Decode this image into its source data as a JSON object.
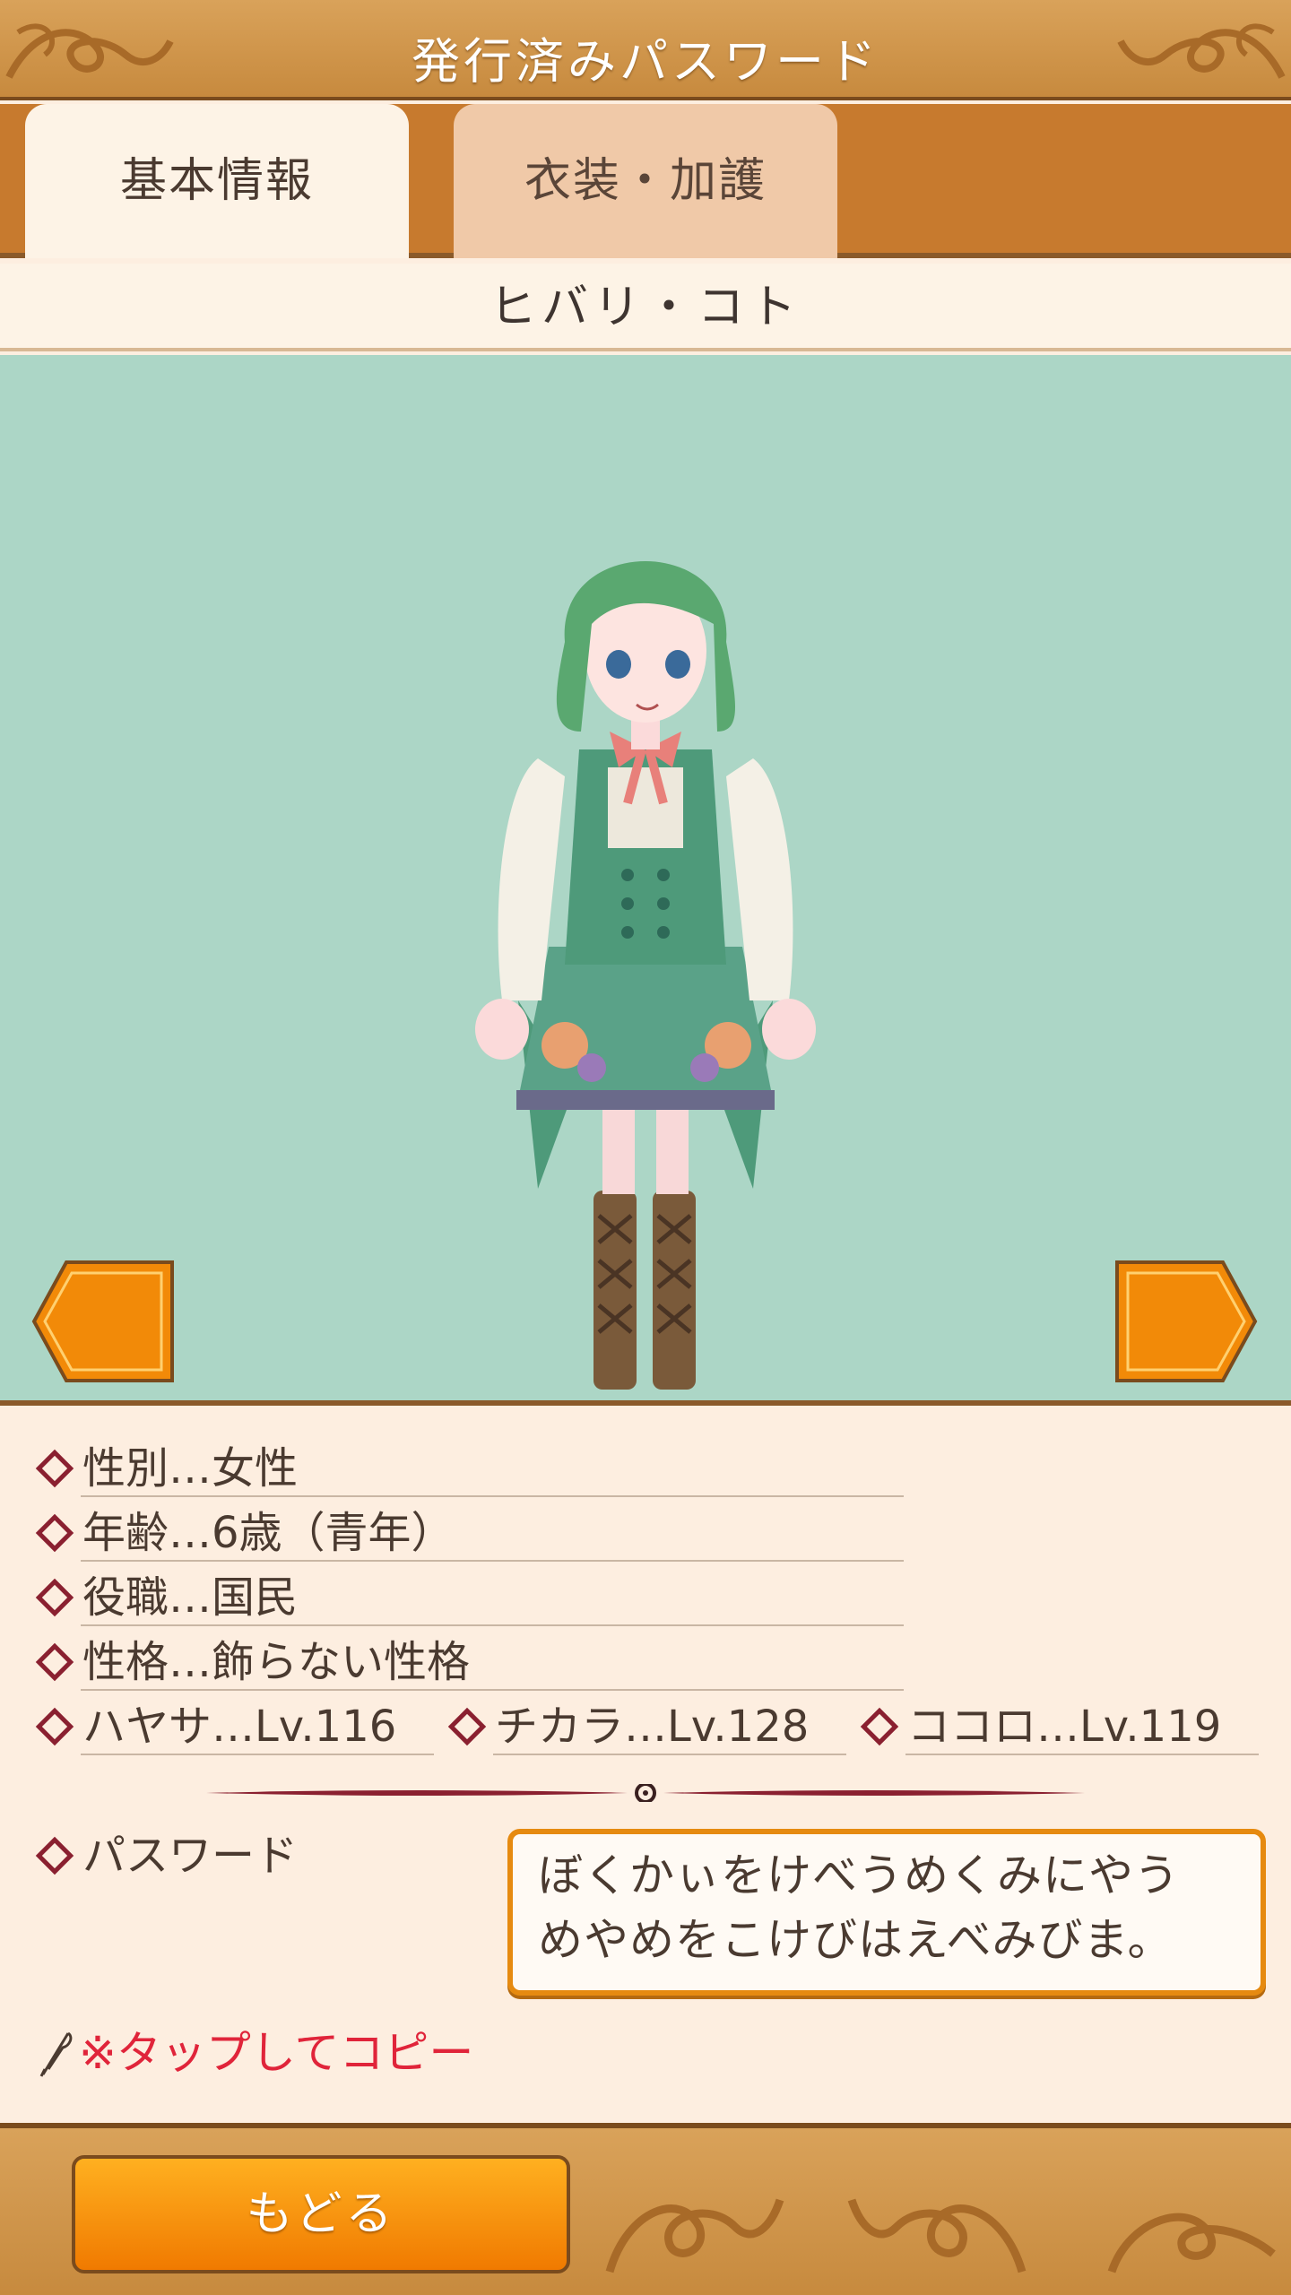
{
  "header": {
    "title": "発行済みパスワード"
  },
  "tabs": [
    {
      "label": "基本情報",
      "active": true
    },
    {
      "label": "衣装・加護",
      "active": false
    }
  ],
  "character": {
    "name": "ヒバリ・コト"
  },
  "info": {
    "gender": "性別…女性",
    "age": "年齢…6歳（青年）",
    "role": "役職…国民",
    "personality": "性格…飾らない性格",
    "stats": [
      "ハヤサ…Lv.116",
      "チカラ…Lv.128",
      "ココロ…Lv.119"
    ]
  },
  "password": {
    "label": "パスワード",
    "line1": "ぼくかぃをけべうめくみにやう",
    "line2": "めやめをこけびはえべみびま。",
    "copy_hint": "※タップしてコピー"
  },
  "footer": {
    "back_label": "もどる"
  },
  "colors": {
    "header": "#c78a3e",
    "tab_bar": "#c77a2e",
    "viewer_bg": "#acd6c6",
    "accent_orange": "#f07a00",
    "copy_red": "#e0243a",
    "diamond": "#8a2030"
  }
}
